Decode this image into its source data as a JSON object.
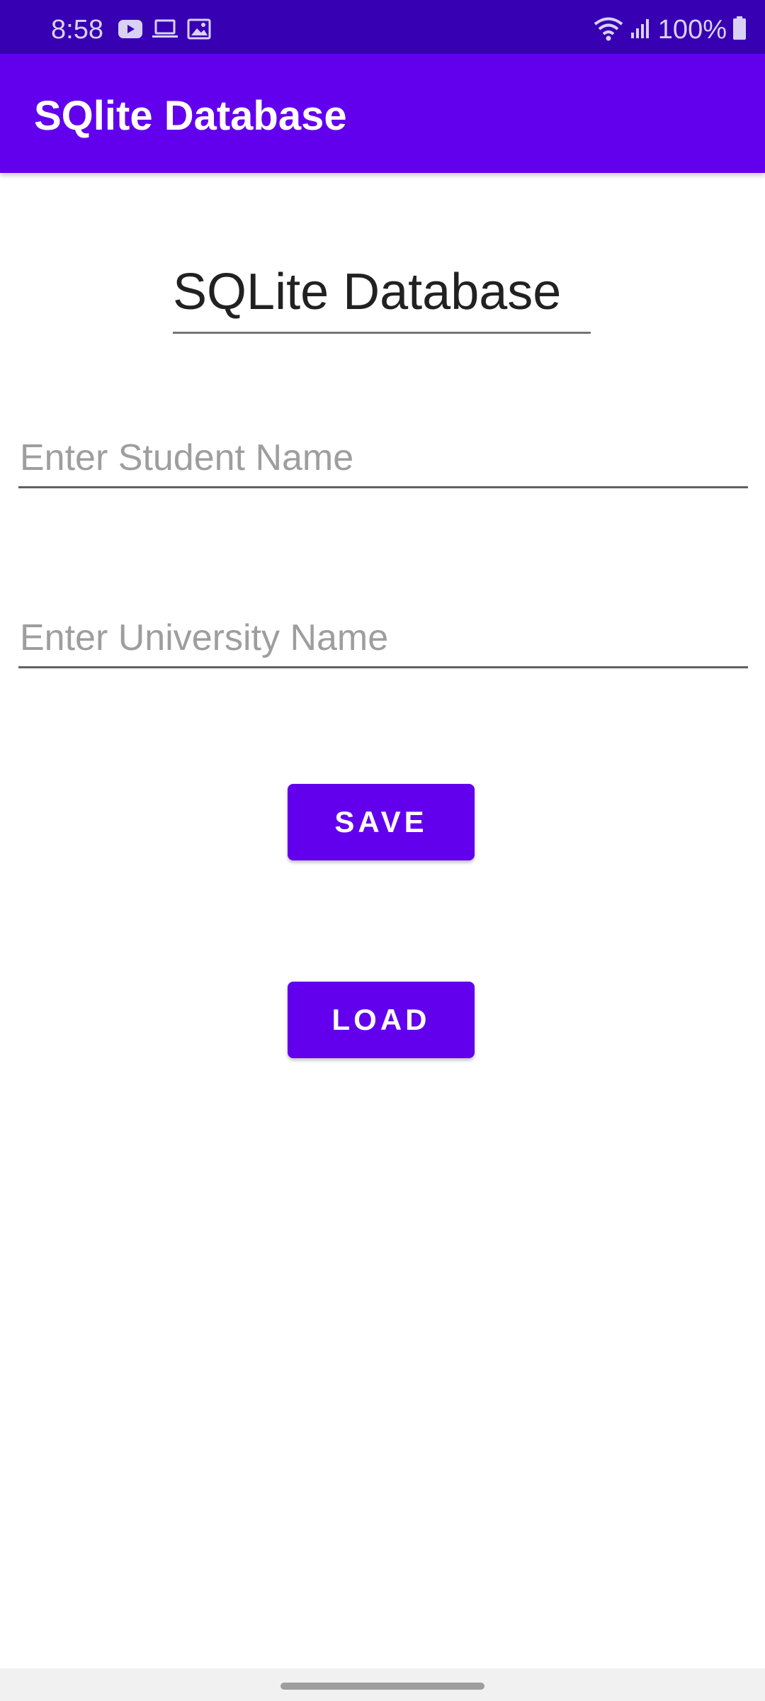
{
  "status_bar": {
    "time": "8:58",
    "battery": "100%",
    "left_icons": [
      "youtube-icon",
      "laptop-icon",
      "image-icon"
    ],
    "right_icons": [
      "wifi-icon",
      "signal-icon",
      "battery-icon"
    ]
  },
  "app_bar": {
    "title": "SQlite Database"
  },
  "form": {
    "heading": "SQLite Database",
    "student_placeholder": "Enter Student Name",
    "university_placeholder": "Enter University Name",
    "student_value": "",
    "university_value": ""
  },
  "buttons": {
    "save_label": "SAVE",
    "load_label": "LOAD"
  },
  "colors": {
    "primary": "#6200ee",
    "primary_dark": "#3700b3",
    "on_primary": "#ffffff"
  }
}
